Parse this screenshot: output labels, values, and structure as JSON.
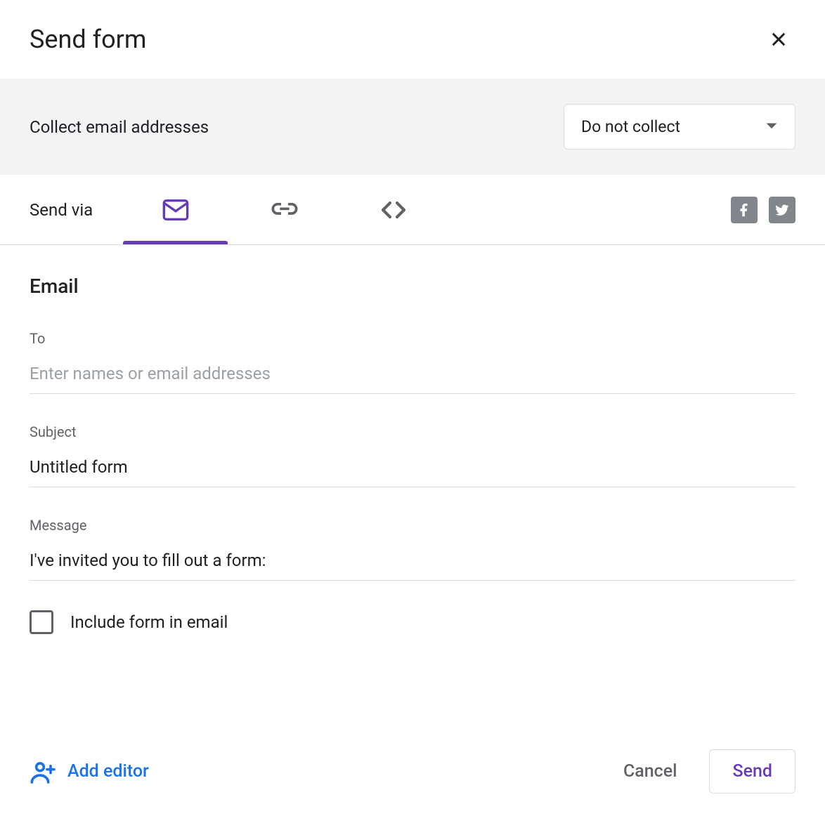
{
  "dialog": {
    "title": "Send form"
  },
  "collect": {
    "label": "Collect email addresses",
    "selected": "Do not collect"
  },
  "send_via": {
    "label": "Send via"
  },
  "email": {
    "section_title": "Email",
    "to_label": "To",
    "to_placeholder": "Enter names or email addresses",
    "to_value": "",
    "subject_label": "Subject",
    "subject_value": "Untitled form",
    "message_label": "Message",
    "message_value": "I've invited you to fill out a form:",
    "include_checkbox_label": "Include form in email"
  },
  "footer": {
    "add_editor": "Add editor",
    "cancel": "Cancel",
    "send": "Send"
  }
}
